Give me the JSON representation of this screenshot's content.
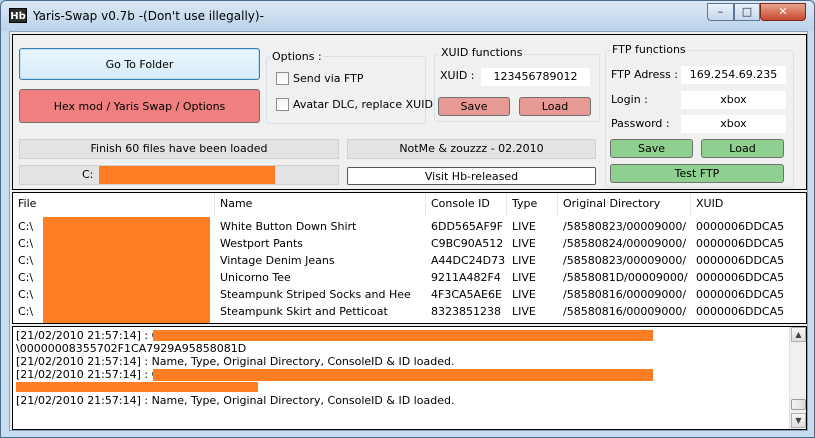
{
  "window": {
    "icon": "Hb",
    "title": "Yaris-Swap v0.7b -(Don't use illegally)-",
    "minimize": "–",
    "maximize": "□",
    "close": "✕"
  },
  "main": {
    "go_to_folder": "Go To Folder",
    "hex_mod": "Hex mod  / Yaris Swap / Options",
    "status": "Finish 60 files have been loaded",
    "path_prefix": "C:",
    "credits": "NotMe & zouzzz  -  02.2010",
    "visit_link": "Visit Hb-released"
  },
  "options": {
    "title": "Options :",
    "send_ftp": "Send via FTP",
    "avatar_dlc": "Avatar DLC, replace XUID"
  },
  "xuid": {
    "title": "XUID functions",
    "label": "XUID :",
    "value": "123456789012",
    "save": "Save",
    "load": "Load"
  },
  "ftp": {
    "title": "FTP functions",
    "address_label": "FTP Adress :",
    "address_value": "169.254.69.235",
    "login_label": "Login :",
    "login_value": "xbox",
    "password_label": "Password :",
    "password_value": "xbox",
    "save": "Save",
    "load": "Load",
    "test": "Test FTP"
  },
  "table": {
    "headers": [
      "File",
      "Name",
      "Console ID",
      "Type",
      "Original Directory",
      "XUID"
    ],
    "rows": [
      {
        "file": "C:\\",
        "name": "White Button Down Shirt",
        "console_id": "6DD565AF9F",
        "type": "LIVE",
        "dir": "/58580823/00009000/",
        "xuid": "0000006DDCA5"
      },
      {
        "file": "C:\\",
        "name": "Westport Pants",
        "console_id": "C9BC90A512",
        "type": "LIVE",
        "dir": "/58580824/00009000/",
        "xuid": "0000006DDCA5"
      },
      {
        "file": "C:\\",
        "name": "Vintage Denim Jeans",
        "console_id": "A44DC24D73",
        "type": "LIVE",
        "dir": "/58580823/00009000/",
        "xuid": "0000006DDCA5"
      },
      {
        "file": "C:\\",
        "name": "Unicorno Tee",
        "console_id": "9211A482F4",
        "type": "LIVE",
        "dir": "/5858081D/00009000/",
        "xuid": "0000006DDCA5"
      },
      {
        "file": "C:\\",
        "name": "Steampunk Striped Socks and Hee",
        "console_id": "4F3CA5AE6E",
        "type": "LIVE",
        "dir": "/58580816/00009000/",
        "xuid": "0000006DDCA5"
      },
      {
        "file": "C:\\",
        "name": "Steampunk Skirt and Petticoat",
        "console_id": "8323851238",
        "type": "LIVE",
        "dir": "/58580816/00009000/",
        "xuid": "0000006DDCA5"
      }
    ]
  },
  "log": {
    "lines": [
      "[21/02/2010 21:57:14]  : C:\\",
      "\\00000008355702F1CA7929A95858081D",
      "[21/02/2010 21:57:14]  : Name, Type, Original Directory, ConsoleID & ID loaded.",
      "[21/02/2010 21:57:14]  : C:\\",
      "",
      "[21/02/2010 21:57:14]  : Name, Type, Original Directory, ConsoleID & ID loaded."
    ]
  }
}
